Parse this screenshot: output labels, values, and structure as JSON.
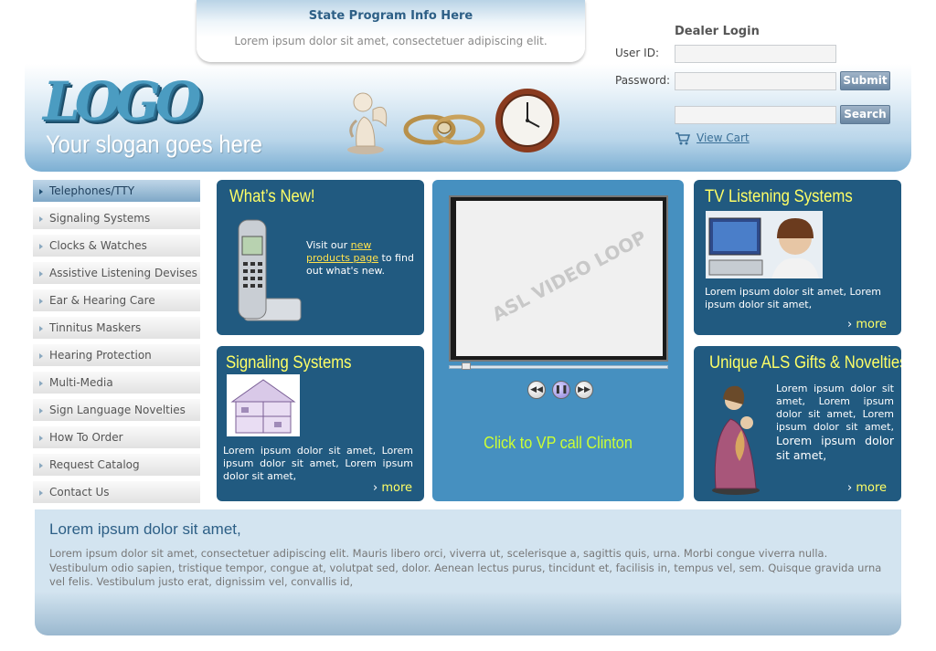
{
  "state_program": {
    "title": "State Program Info Here",
    "text": "Lorem ipsum dolor sit amet, consectetuer adipiscing elit."
  },
  "branding": {
    "logo_text": "LOGO",
    "slogan": "Your slogan goes here"
  },
  "dealer_login": {
    "title": "Dealer Login",
    "user_id_label": "User ID:",
    "user_id_value": "",
    "password_label": "Password:",
    "password_value": "",
    "submit_label": "Submit",
    "search_value": "",
    "search_label": "Search",
    "view_cart_label": "View Cart"
  },
  "menu": {
    "items": [
      {
        "label": "Telephones/TTY",
        "active": true
      },
      {
        "label": "Signaling Systems"
      },
      {
        "label": "Clocks & Watches"
      },
      {
        "label": "Assistive Listening Devises"
      },
      {
        "label": "Ear & Hearing Care"
      },
      {
        "label": "Tinnitus Maskers"
      },
      {
        "label": "Hearing Protection"
      },
      {
        "label": "Multi-Media"
      },
      {
        "label": "Sign Language Novelties"
      },
      {
        "label": "How To Order"
      },
      {
        "label": "Request Catalog"
      },
      {
        "label": "Contact Us"
      }
    ]
  },
  "whats_new": {
    "title": "What’s New!",
    "text_before": "Visit our ",
    "link_text": "new products page",
    "text_after": " to find out what's new."
  },
  "signaling": {
    "title": "Signaling Systems",
    "text": "Lorem ipsum dolor sit amet, Lorem ipsum dolor sit amet, Lorem ipsum dolor sit amet,",
    "more": "more"
  },
  "video": {
    "watermark": "ASL VIDEO LOOP",
    "call_label": "Click to VP call Clinton"
  },
  "tv_listening": {
    "title": "TV Listening Systems",
    "text": "Lorem ipsum dolor sit amet, Lorem ipsum dolor sit amet,",
    "more": "more"
  },
  "als_gifts": {
    "title": "Unique ALS Gifts & Novelties",
    "text": "Lorem ipsum dolor sit amet, Lorem ipsum dolor sit amet, Lorem ipsum dolor sit amet,",
    "text_large": "Lorem ipsum dolor sit amet,",
    "more": "more"
  },
  "bottom": {
    "title": "Lorem ipsum dolor sit amet,",
    "text": "Lorem ipsum dolor sit amet, consectetuer adipiscing elit. Mauris libero orci, viverra ut, scelerisque a, sagittis quis, urna. Morbi congue viverra nulla. Vestibulum odio sapien, tristique tempor, congue at, volutpat sed, dolor. Aenean lectus purus, tincidunt et, facilisis in, tempus vel, sem. Quisque gravida urna vel felis. Vestibulum justo erat, dignissim vel, convallis id,"
  },
  "colors": {
    "box_bg": "#215a80",
    "video_bg": "#4690c0",
    "title_yellow": "#ffff66",
    "link_yellow": "#ffe24d",
    "header_blue": "#7cafd3"
  }
}
